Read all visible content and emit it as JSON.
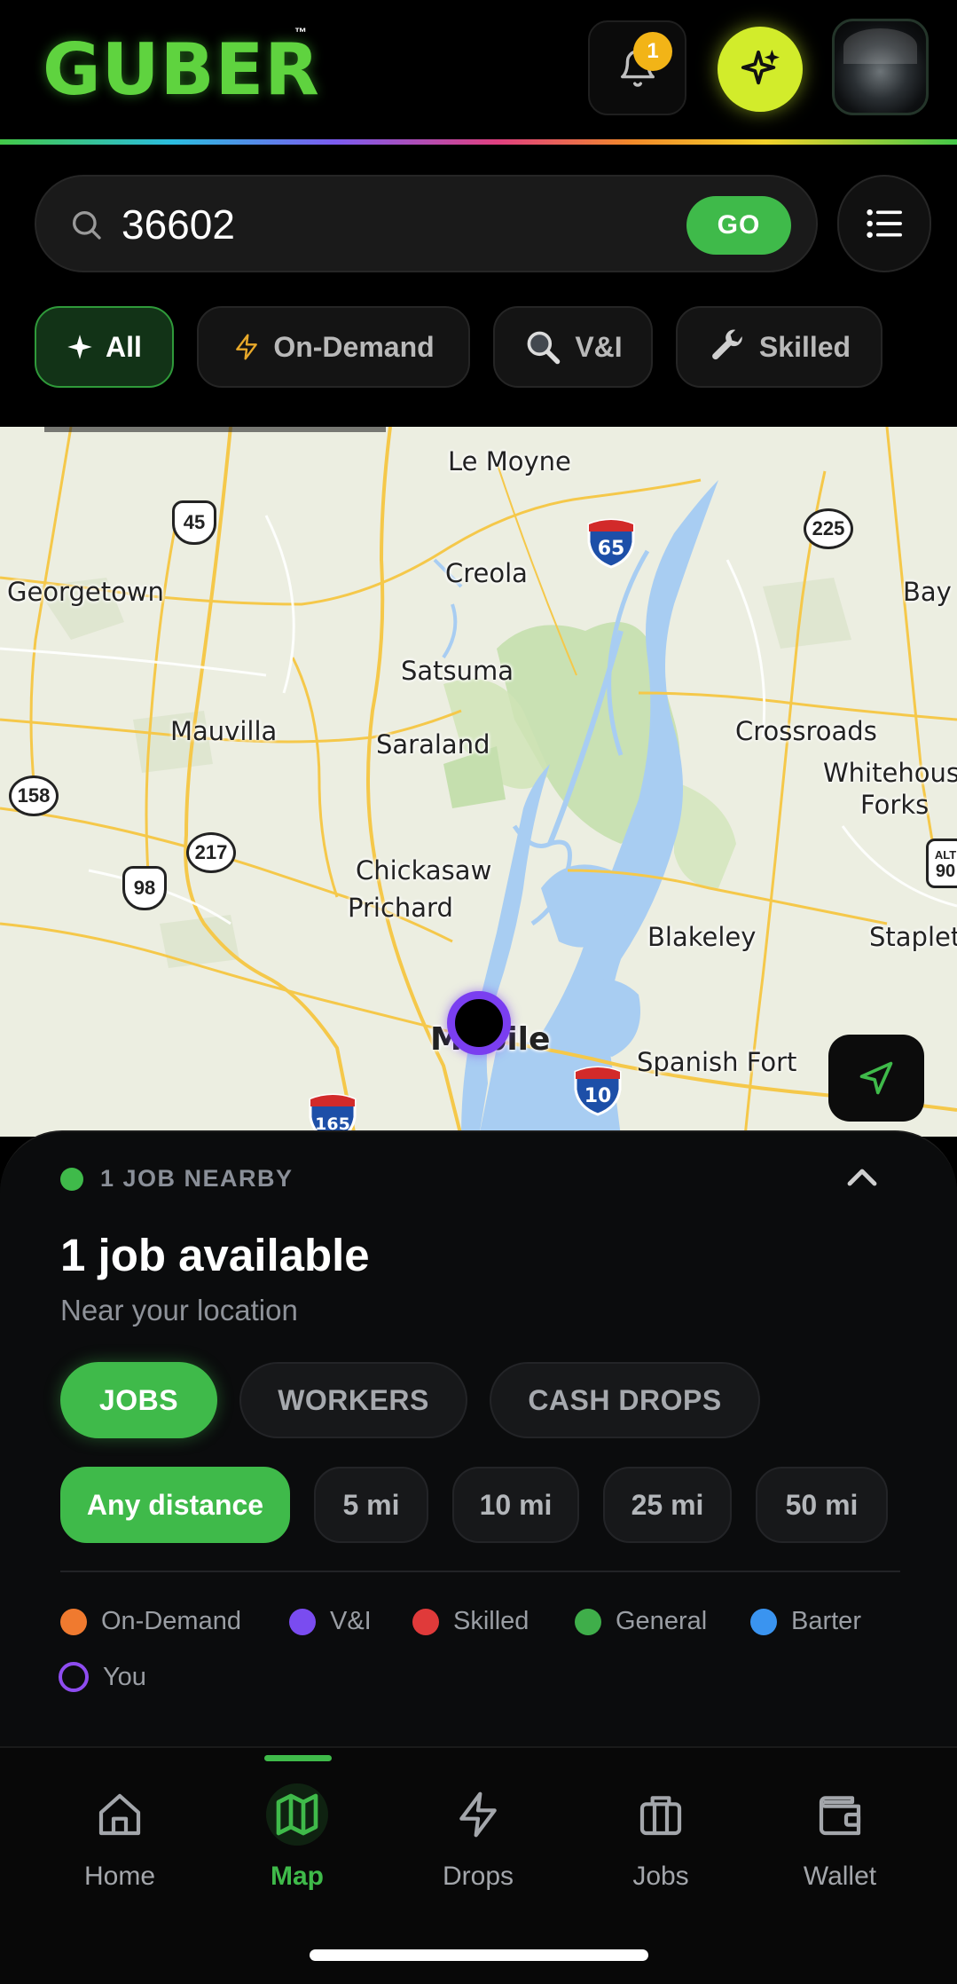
{
  "header": {
    "logo": "GUBER",
    "logo_tm": "™",
    "notification_count": "1",
    "icons": {
      "bell": "bell-icon",
      "ai": "sparkle-icon",
      "avatar": "avatar"
    }
  },
  "search": {
    "value": "36602",
    "go_label": "GO",
    "list_icon": "list-icon"
  },
  "filters": [
    {
      "label": "All",
      "icon": "sparkle-icon",
      "active": true
    },
    {
      "label": "On-Demand",
      "icon": "lightning-icon",
      "active": false
    },
    {
      "label": "V&I",
      "icon": "magnifier-icon",
      "active": false
    },
    {
      "label": "Skilled",
      "icon": "wrench-icon",
      "active": false
    }
  ],
  "map": {
    "labels": {
      "le_moyne": "Le Moyne",
      "georgetown": "Georgetown",
      "creola": "Creola",
      "bay": "Bay",
      "satsuma": "Satsuma",
      "mauvilla": "Mauvilla",
      "saraland": "Saraland",
      "crossroads": "Crossroads",
      "whitehouse": "Whitehous",
      "forks": "Forks",
      "chickasaw": "Chickasaw",
      "prichard": "Prichard",
      "blakeley": "Blakeley",
      "stapleton": "Stapleto",
      "mobile": "Mobile",
      "spanish_fort": "Spanish Fort"
    },
    "shields": {
      "us45": "45",
      "i65": "65",
      "r225": "225",
      "r158": "158",
      "r217": "217",
      "us98": "98",
      "i10": "10",
      "i165": "165",
      "alt_top": "ALT",
      "alt_num": "90"
    }
  },
  "sheet": {
    "nearby_text": "1 JOB NEARBY",
    "title": "1 job available",
    "subtitle": "Near your location",
    "tabs": [
      "JOBS",
      "WORKERS",
      "CASH DROPS"
    ],
    "distances": [
      "Any distance",
      "5 mi",
      "10 mi",
      "25 mi",
      "50 mi"
    ],
    "legend": [
      {
        "label": "On-Demand",
        "color": "#f07a2f"
      },
      {
        "label": "V&I",
        "color": "#7a4cf0"
      },
      {
        "label": "Skilled",
        "color": "#e03a3a"
      },
      {
        "label": "General",
        "color": "#3fae4a"
      },
      {
        "label": "Barter",
        "color": "#3a94f0"
      },
      {
        "label": "You",
        "color": "#8e4cf0"
      }
    ]
  },
  "nav": {
    "items": [
      {
        "label": "Home",
        "icon": "home-icon"
      },
      {
        "label": "Map",
        "icon": "map-icon",
        "active": true
      },
      {
        "label": "Drops",
        "icon": "lightning-icon"
      },
      {
        "label": "Jobs",
        "icon": "briefcase-icon"
      },
      {
        "label": "Wallet",
        "icon": "wallet-icon"
      }
    ]
  },
  "colors": {
    "accent_green": "#3fba4a",
    "logo_green": "#5fd33f",
    "badge_yellow": "#f2b417",
    "ai_yellow": "#d2ec2b"
  }
}
